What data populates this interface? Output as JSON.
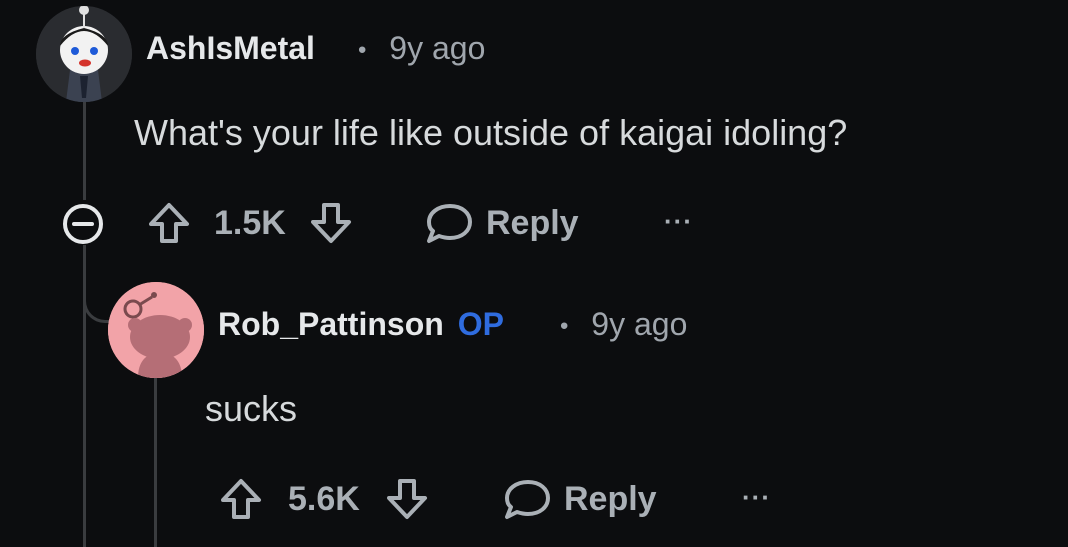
{
  "comments": [
    {
      "username": "AshIsMetal",
      "op_badge": "",
      "separator": "•",
      "age": "9y ago",
      "body": "What's your life like outside of kaigai idoling?",
      "score": "1.5K",
      "reply_label": "Reply",
      "more_label": "···",
      "avatar_icon": "snoo-custom-avatar-icon",
      "collapse_icon": "collapse-minus-icon"
    },
    {
      "username": "Rob_Pattinson",
      "op_badge": "OP",
      "separator": "•",
      "age": "9y ago",
      "body": "sucks",
      "score": "5.6K",
      "reply_label": "Reply",
      "more_label": "···",
      "avatar_icon": "snoo-default-avatar-icon"
    }
  ],
  "colors": {
    "background": "#0c0d0f",
    "op_badge": "#2f6cdf",
    "text": "#d7dadc",
    "muted": "#a0a6ad",
    "default_avatar_bg": "#f2a3a8"
  }
}
